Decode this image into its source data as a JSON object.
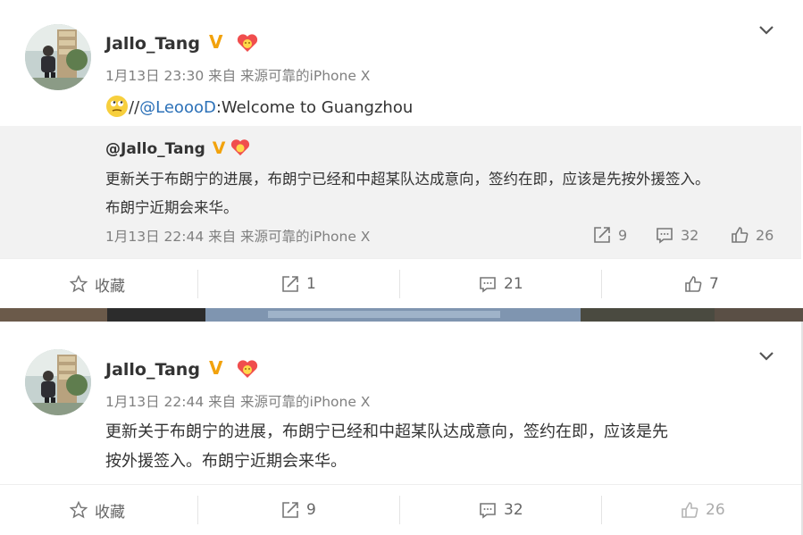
{
  "posts": [
    {
      "username": "Jallo_Tang",
      "verified_mark": "V",
      "meta": "1月13日 23:30 来自 来源可靠的iPhone X",
      "text_prefix": "//",
      "mention": "@LeoooD",
      "text_suffix": ":Welcome to Guangzhou",
      "repost": {
        "username": "@Jallo_Tang",
        "line1": "更新关于布朗宁的进展，布朗宁已经和中超某队达成意向，签约在即，应该是先按外援签入。",
        "line2": "布朗宁近期会来华。",
        "meta": "1月13日 22:44 来自 来源可靠的iPhone X",
        "reposts": "9",
        "comments": "32",
        "likes": "26"
      },
      "actions": {
        "favorite": "收藏",
        "reposts": "1",
        "comments": "21",
        "likes": "7"
      }
    },
    {
      "username": "Jallo_Tang",
      "verified_mark": "V",
      "meta": "1月13日 22:44 来自 来源可靠的iPhone X",
      "line1": "更新关于布朗宁的进展，布朗宁已经和中超某队达成意向，签约在即，应该是先",
      "line2": "按外援签入。布朗宁近期会来华。",
      "actions": {
        "favorite": "收藏",
        "reposts": "9",
        "comments": "32",
        "likes": "26"
      }
    }
  ],
  "colors": {
    "link": "#2c71b8",
    "meta": "#808080",
    "quote_bg": "#f2f2f2",
    "badge": "#f2a20c"
  }
}
